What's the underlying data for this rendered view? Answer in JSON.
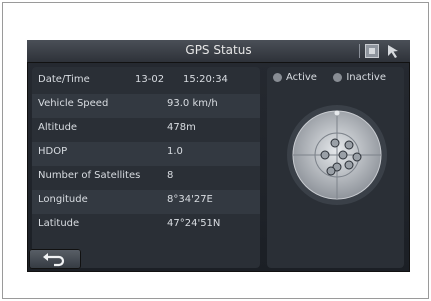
{
  "window": {
    "title": "GPS Status"
  },
  "info": {
    "date_time_label": "Date/Time",
    "date": "13-02",
    "time": "15:20:34",
    "rows": [
      {
        "label": "Vehicle Speed",
        "value": "93.0 km/h"
      },
      {
        "label": "Altitude",
        "value": "478m"
      },
      {
        "label": "HDOP",
        "value": "1.0"
      },
      {
        "label": "Number of Satellites",
        "value": "8"
      },
      {
        "label": "Longitude",
        "value": "8°34'27E"
      },
      {
        "label": "Latitude",
        "value": "47°24'51N"
      }
    ]
  },
  "legend": {
    "active": "Active",
    "inactive": "Inactive"
  },
  "icons": {
    "settings": "settings-icon",
    "cursor": "cursor-icon",
    "back": "back-icon"
  },
  "colors": {
    "background": "#1b1f25",
    "panel": "#2a2f36",
    "text": "#d9dde2"
  }
}
